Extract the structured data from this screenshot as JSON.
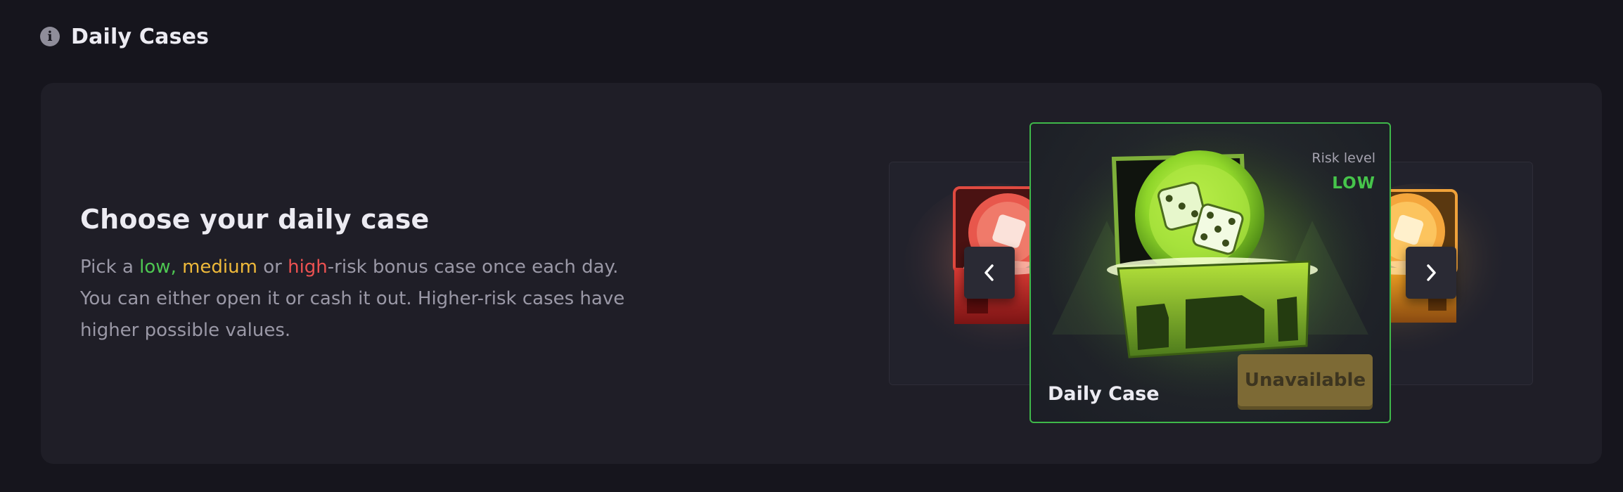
{
  "header": {
    "icon": "info-icon",
    "title": "Daily Cases"
  },
  "intro": {
    "heading": "Choose your daily case",
    "text_before": "Pick a ",
    "risk_low": "low",
    "sep1": ", ",
    "risk_medium": "medium",
    "sep2": " or ",
    "risk_high": "high",
    "text_after": "-risk bonus case once each day. You can either open it or cash it out. Higher-risk cases have higher possible values."
  },
  "carousel": {
    "selected_case": {
      "name": "Daily Case",
      "risk_label": "Risk level",
      "risk_value": "LOW",
      "button_label": "Unavailable"
    },
    "prev_icon": "chevron-left-icon",
    "next_icon": "chevron-right-icon"
  },
  "colors": {
    "background": "#16151d",
    "panel": "#1f1e27",
    "low": "#4ec752",
    "medium": "#efb93a",
    "high": "#ec5151",
    "selected_border": "#3fb84a",
    "button_disabled": "#7d6a35"
  }
}
